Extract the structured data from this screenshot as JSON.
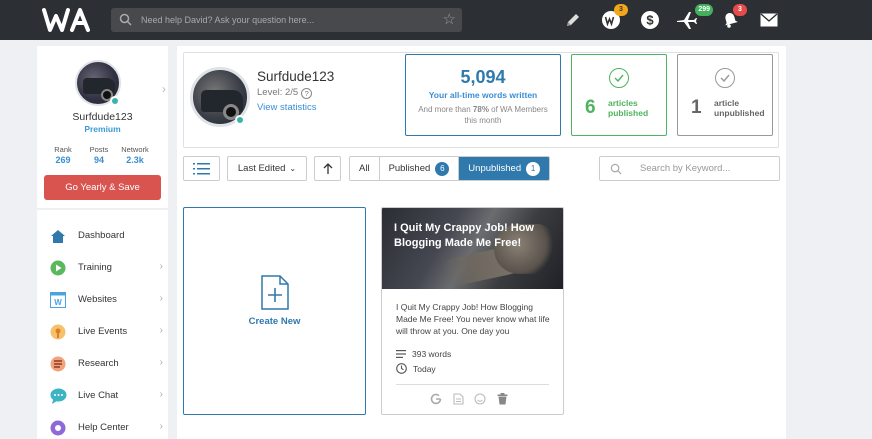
{
  "topbar": {
    "search_placeholder": "Need help David? Ask your question here...",
    "icons": [
      "logo-wa",
      "search-icon",
      "star-icon",
      "pencil-icon",
      "wa-credit-icon",
      "dollar-icon",
      "airplane-icon",
      "bell-icon",
      "mail-icon"
    ],
    "badges": {
      "credits": "3",
      "flights": "299",
      "notifications": "3"
    },
    "colors": {
      "bg": "#2c2f33",
      "badge_yellow": "#f2a71b",
      "badge_green": "#43b05c",
      "badge_red": "#e54b4b"
    }
  },
  "sidebar": {
    "profile": {
      "username": "Surfdude123",
      "membership": "Premium",
      "stats": [
        {
          "label": "Rank",
          "value": "269"
        },
        {
          "label": "Posts",
          "value": "94"
        },
        {
          "label": "Network",
          "value": "2.3k"
        }
      ],
      "cta_label": "Go Yearly & Save"
    },
    "nav": [
      {
        "label": "Dashboard",
        "icon": "home-icon",
        "has_children": false
      },
      {
        "label": "Training",
        "icon": "play-icon",
        "has_children": true
      },
      {
        "label": "Websites",
        "icon": "website-icon",
        "has_children": true
      },
      {
        "label": "Live Events",
        "icon": "live-events-icon",
        "has_children": true
      },
      {
        "label": "Research",
        "icon": "research-icon",
        "has_children": true
      },
      {
        "label": "Live Chat",
        "icon": "chat-icon",
        "has_children": true
      },
      {
        "label": "Help Center",
        "icon": "help-center-icon",
        "has_children": true
      }
    ]
  },
  "header": {
    "username": "Surfdude123",
    "level": "Level: 2/5",
    "view_stats": "View statistics",
    "words": {
      "count": "5,094",
      "label": "Your all-time words written",
      "sub_pre": "And more than ",
      "sub_pct": "78%",
      "sub_post": " of WA Members this month"
    },
    "published": {
      "count": "6",
      "line1": "articles",
      "line2": "published"
    },
    "unpublished": {
      "count": "1",
      "line1": "article",
      "line2": "unpublished"
    }
  },
  "toolbar": {
    "sort_label": "Last Edited",
    "filters": [
      {
        "label": "All",
        "count": null,
        "active": false
      },
      {
        "label": "Published",
        "count": "6",
        "active": false
      },
      {
        "label": "Unpublished",
        "count": "1",
        "active": true
      }
    ],
    "search_placeholder": "Search by Keyword..."
  },
  "cards": {
    "create_label": "Create New",
    "article": {
      "title": "I Quit My Crappy Job! How Blogging Made Me Free!",
      "excerpt": "I Quit My Crappy Job! How Blogging Made Me Free! You never know what life will throw at you. One day you",
      "words": "393 words",
      "date": "Today",
      "actions": [
        "google-icon",
        "document-icon",
        "face-icon",
        "trash-icon"
      ]
    }
  },
  "colors": {
    "accent": "#2f79ac",
    "link": "#3a8ed4",
    "success": "#4fb35f",
    "danger": "#d9534f"
  }
}
